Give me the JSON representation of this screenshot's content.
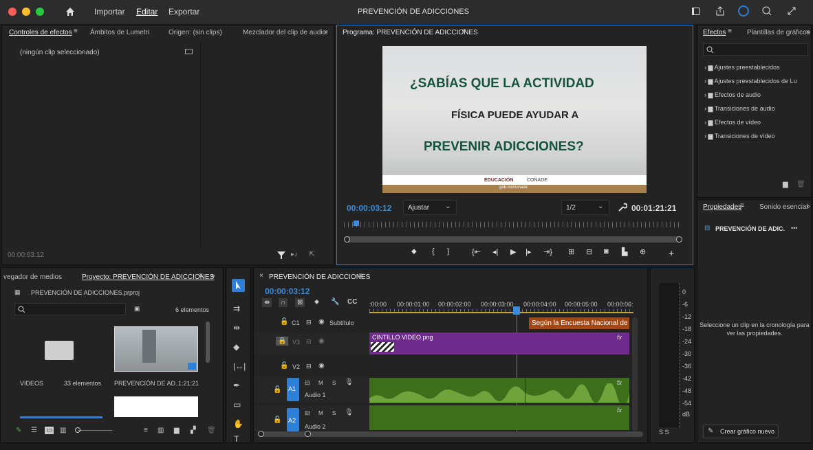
{
  "window": {
    "title": "PREVENCIÓN DE ADICCIONES"
  },
  "menu": {
    "importar": "Importar",
    "editar": "Editar",
    "exportar": "Exportar"
  },
  "effect_controls": {
    "tabs": [
      "Controles de efectos",
      "Ámbitos de Lumetri",
      "Origen: (sin clips)",
      "Mezclador del clip de audio:"
    ],
    "no_clip": "(ningún clip seleccionado)",
    "timecode": "00:00:03:12"
  },
  "program": {
    "tab": "Programa: PREVENCIÓN DE ADICCIONES",
    "frame_line1": "¿SABÍAS QUE LA ACTIVIDAD",
    "frame_line2": "FÍSICA PUEDE AYUDAR A",
    "frame_line3": "PREVENIR ADICCIONES?",
    "frame_logo1": "EDUCACIÓN",
    "frame_logo2": "CONADE",
    "frame_footer": "gob.mx/conade",
    "timecode": "00:00:03:12",
    "fit": "Ajustar",
    "resolution": "1/2",
    "duration": "00:01:21:21"
  },
  "effects": {
    "tabs": [
      "Efectos",
      "Plantillas de gráficos"
    ],
    "folders": [
      "Ajustes preestablecidos",
      "Ajustes preestablecidos de Lu",
      "Efectos de audio",
      "Transiciones de audio",
      "Efectos de vídeo",
      "Transiciones de vídeo"
    ]
  },
  "properties": {
    "tabs": [
      "Propiedades",
      "Sonido esencial"
    ],
    "sequence": "PREVENCIÓN DE ADIC.",
    "hint": "Seleccione un clip en la cronología para ver las propiedades.",
    "new_graphic": "Crear gráfico nuevo"
  },
  "project": {
    "tabs": [
      "vegador de medios",
      "Proyecto: PREVENCIÓN DE ADICCIONES"
    ],
    "file": "PREVENCIÓN DE ADICCIONES.prproj",
    "count": "6 elementos",
    "items": [
      {
        "name": "VIDEOS",
        "info": "33 elementos"
      },
      {
        "name": "PREVENCIÓN DE AD...",
        "info": "1:21:21"
      }
    ]
  },
  "timeline": {
    "tab": "PREVENCIÓN DE ADICCIONES",
    "timecode": "00:00:03:12",
    "ruler": [
      ":00:00",
      "00:00:01:00",
      "00:00:02:00",
      "00:00:03:00",
      "00:00:04:00",
      "00:00:05:00",
      "00:00:06:"
    ],
    "tracks": {
      "c1": "C1",
      "subtitle": "Subtítulo",
      "v3": "V3",
      "v2": "V2",
      "a1": "A1",
      "a2": "A2",
      "audio1": "Audio 1",
      "audio2": "Audio 2",
      "m": "M",
      "s": "S"
    },
    "caption_clip": "Según la Encuesta Nacional de",
    "png_clip": "CINTILLO VIDEO.png",
    "fx": "fx"
  },
  "meter": {
    "scale": [
      "0",
      "-6",
      "-12",
      "-18",
      "-24",
      "-30",
      "-36",
      "-42",
      "-48",
      "-54",
      "dB"
    ],
    "footer": "S  S"
  },
  "colors": {
    "accent": "#2f7fd6",
    "purple": "#6e2b8c",
    "green": "#3c6e1c",
    "caption": "#a34713"
  }
}
